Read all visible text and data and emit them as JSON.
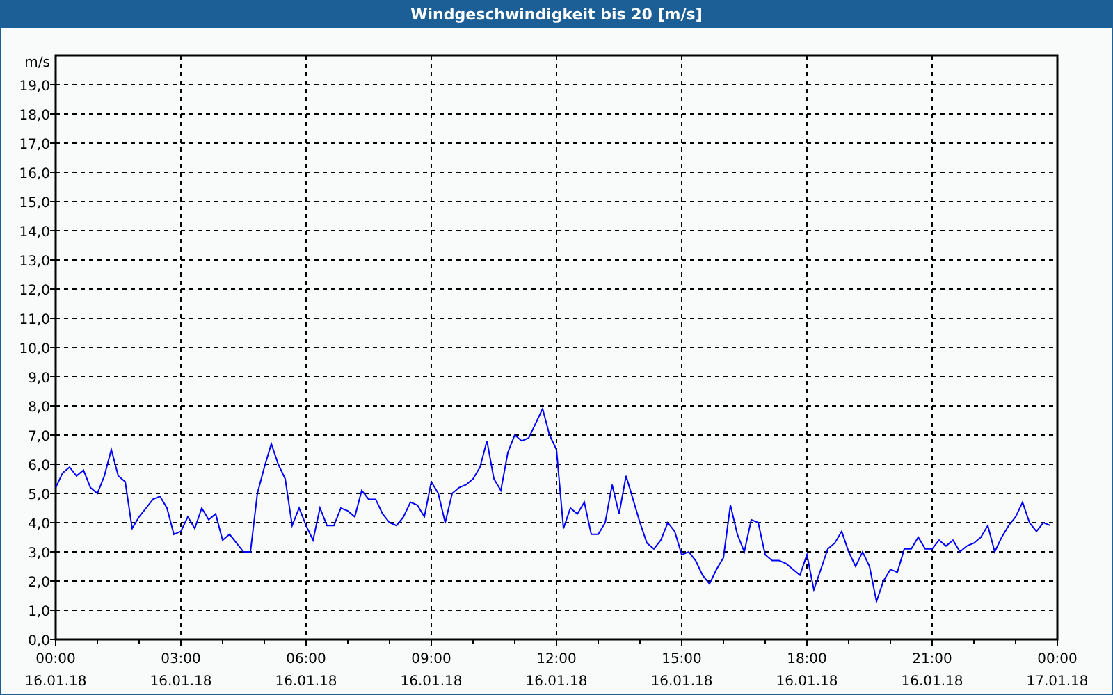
{
  "window": {
    "title": "Windgeschwindigkeit bis 20 [m/s]"
  },
  "chart_data": {
    "type": "line",
    "ylabel": "m/s",
    "ylim": [
      0,
      20
    ],
    "grid": true,
    "yticks": [
      {
        "value": 0,
        "label": "0,0"
      },
      {
        "value": 1,
        "label": "1,0"
      },
      {
        "value": 2,
        "label": "2,0"
      },
      {
        "value": 3,
        "label": "3,0"
      },
      {
        "value": 4,
        "label": "4,0"
      },
      {
        "value": 5,
        "label": "5,0"
      },
      {
        "value": 6,
        "label": "6,0"
      },
      {
        "value": 7,
        "label": "7,0"
      },
      {
        "value": 8,
        "label": "8,0"
      },
      {
        "value": 9,
        "label": "9,0"
      },
      {
        "value": 10,
        "label": "10,0"
      },
      {
        "value": 11,
        "label": "11,0"
      },
      {
        "value": 12,
        "label": "12,0"
      },
      {
        "value": 13,
        "label": "13,0"
      },
      {
        "value": 14,
        "label": "14,0"
      },
      {
        "value": 15,
        "label": "15,0"
      },
      {
        "value": 16,
        "label": "16,0"
      },
      {
        "value": 17,
        "label": "17,0"
      },
      {
        "value": 18,
        "label": "18,0"
      },
      {
        "value": 19,
        "label": "19,0"
      }
    ],
    "categories": [
      "00:00\n16.01.18",
      null,
      null,
      null,
      null,
      null,
      null,
      null,
      null,
      null,
      null,
      null,
      null,
      null,
      null,
      null,
      null,
      null,
      "03:00\n16.01.18",
      null,
      null,
      null,
      null,
      null,
      null,
      null,
      null,
      null,
      null,
      null,
      null,
      null,
      null,
      null,
      null,
      null,
      "06:00\n16.01.18",
      null,
      null,
      null,
      null,
      null,
      null,
      null,
      null,
      null,
      null,
      null,
      null,
      null,
      null,
      null,
      null,
      null,
      "09:00\n16.01.18",
      null,
      null,
      null,
      null,
      null,
      null,
      null,
      null,
      null,
      null,
      null,
      null,
      null,
      null,
      null,
      null,
      null,
      "12:00\n16.01.18",
      null,
      null,
      null,
      null,
      null,
      null,
      null,
      null,
      null,
      null,
      null,
      null,
      null,
      null,
      null,
      null,
      null,
      "15:00\n16.01.18",
      null,
      null,
      null,
      null,
      null,
      null,
      null,
      null,
      null,
      null,
      null,
      null,
      null,
      null,
      null,
      null,
      null,
      "18:00\n16.01.18",
      null,
      null,
      null,
      null,
      null,
      null,
      null,
      null,
      null,
      null,
      null,
      null,
      null,
      null,
      null,
      null,
      null,
      "21:00\n16.01.18",
      null,
      null,
      null,
      null,
      null,
      null,
      null,
      null,
      null,
      null,
      null,
      null,
      null,
      null,
      null,
      null,
      null,
      "00:00\n17.01.18"
    ],
    "series": [
      {
        "color": "#0000ff",
        "values": [
          5.2,
          5.7,
          5.9,
          5.6,
          5.8,
          5.2,
          5.0,
          5.6,
          6.5,
          5.6,
          5.4,
          3.8,
          4.2,
          4.5,
          4.8,
          4.9,
          4.5,
          3.6,
          3.7,
          4.2,
          3.8,
          4.5,
          4.1,
          4.3,
          3.4,
          3.6,
          3.3,
          3.0,
          3.0,
          5.0,
          5.9,
          6.7,
          6.0,
          5.5,
          3.9,
          4.5,
          3.9,
          3.4,
          4.5,
          3.9,
          3.9,
          4.5,
          4.4,
          4.2,
          5.1,
          4.8,
          4.8,
          4.3,
          4.0,
          3.9,
          4.2,
          4.7,
          4.6,
          4.2,
          5.4,
          5.0,
          4.0,
          5.0,
          5.2,
          5.3,
          5.5,
          5.9,
          6.8,
          5.5,
          5.1,
          6.4,
          7.0,
          6.8,
          6.9,
          7.4,
          7.9,
          7.0,
          6.5,
          3.8,
          4.5,
          4.3,
          4.7,
          3.6,
          3.6,
          4.0,
          5.3,
          4.3,
          5.6,
          4.8,
          4.0,
          3.3,
          3.1,
          3.4,
          4.0,
          3.7,
          2.9,
          3.0,
          2.7,
          2.2,
          1.9,
          2.4,
          2.8,
          4.6,
          3.6,
          3.0,
          4.1,
          4.0,
          2.9,
          2.7,
          2.7,
          2.6,
          2.4,
          2.2,
          2.9,
          1.7,
          2.4,
          3.1,
          3.3,
          3.7,
          3.0,
          2.5,
          3.0,
          2.5,
          1.3,
          2.0,
          2.4,
          2.3,
          3.1,
          3.1,
          3.5,
          3.1,
          3.1,
          3.4,
          3.2,
          3.4,
          3.0,
          3.2,
          3.3,
          3.5,
          3.9,
          3.0,
          3.5,
          3.9,
          4.2,
          4.7,
          4.0,
          3.7,
          4.0,
          3.9,
          null
        ]
      }
    ]
  }
}
